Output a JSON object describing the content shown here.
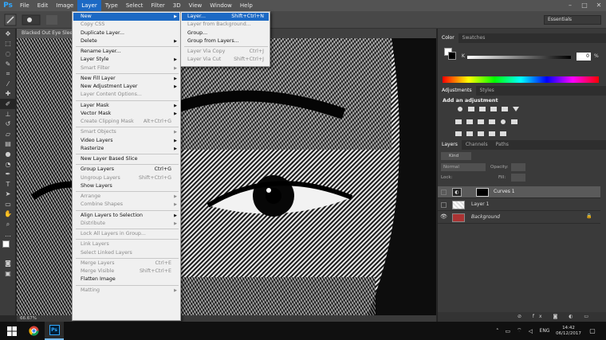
{
  "app": {
    "logo": "Ps"
  },
  "menubar": {
    "items": [
      "File",
      "Edit",
      "Image",
      "Layer",
      "Type",
      "Select",
      "Filter",
      "3D",
      "View",
      "Window",
      "Help"
    ],
    "active": "Layer"
  },
  "options": {
    "workspace": "Essentials"
  },
  "document": {
    "tab_title": "Blacked Out Eye Sleepless",
    "zoom": "66.67%"
  },
  "layer_menu": {
    "items": [
      {
        "label": "New",
        "arrow": true,
        "selected": true
      },
      {
        "label": "Copy CSS",
        "disabled": true
      },
      {
        "label": "Duplicate Layer..."
      },
      {
        "label": "Delete",
        "arrow": true
      },
      {
        "sep": true
      },
      {
        "label": "Rename Layer..."
      },
      {
        "label": "Layer Style",
        "arrow": true
      },
      {
        "label": "Smart Filter",
        "arrow": true,
        "disabled": true
      },
      {
        "sep": true
      },
      {
        "label": "New Fill Layer",
        "arrow": true
      },
      {
        "label": "New Adjustment Layer",
        "arrow": true
      },
      {
        "label": "Layer Content Options...",
        "disabled": true
      },
      {
        "sep": true
      },
      {
        "label": "Layer Mask",
        "arrow": true
      },
      {
        "label": "Vector Mask",
        "arrow": true
      },
      {
        "label": "Create Clipping Mask",
        "shortcut": "Alt+Ctrl+G",
        "disabled": true
      },
      {
        "sep": true
      },
      {
        "label": "Smart Objects",
        "arrow": true,
        "disabled": true
      },
      {
        "label": "Video Layers",
        "arrow": true
      },
      {
        "label": "Rasterize",
        "arrow": true
      },
      {
        "sep": true
      },
      {
        "label": "New Layer Based Slice"
      },
      {
        "sep": true
      },
      {
        "label": "Group Layers",
        "shortcut": "Ctrl+G"
      },
      {
        "label": "Ungroup Layers",
        "shortcut": "Shift+Ctrl+G",
        "disabled": true
      },
      {
        "label": "Show Layers"
      },
      {
        "sep": true
      },
      {
        "label": "Arrange",
        "arrow": true,
        "disabled": true
      },
      {
        "label": "Combine Shapes",
        "arrow": true,
        "disabled": true
      },
      {
        "sep": true
      },
      {
        "label": "Align Layers to Selection",
        "arrow": true
      },
      {
        "label": "Distribute",
        "arrow": true,
        "disabled": true
      },
      {
        "sep": true
      },
      {
        "label": "Lock All Layers in Group...",
        "disabled": true
      },
      {
        "sep": true
      },
      {
        "label": "Link Layers",
        "disabled": true
      },
      {
        "label": "Select Linked Layers",
        "disabled": true
      },
      {
        "sep": true
      },
      {
        "label": "Merge Layers",
        "shortcut": "Ctrl+E",
        "disabled": true
      },
      {
        "label": "Merge Visible",
        "shortcut": "Shift+Ctrl+E",
        "disabled": true
      },
      {
        "label": "Flatten Image"
      },
      {
        "sep": true
      },
      {
        "label": "Matting",
        "arrow": true,
        "disabled": true
      }
    ]
  },
  "new_submenu": {
    "items": [
      {
        "label": "Layer...",
        "shortcut": "Shift+Ctrl+N",
        "selected": true
      },
      {
        "label": "Layer from Background...",
        "disabled": true
      },
      {
        "label": "Group..."
      },
      {
        "label": "Group from Layers..."
      },
      {
        "sep": true
      },
      {
        "label": "Layer Via Copy",
        "shortcut": "Ctrl+J",
        "disabled": true
      },
      {
        "label": "Layer Via Cut",
        "shortcut": "Shift+Ctrl+J",
        "disabled": true
      }
    ]
  },
  "color_panel": {
    "tabs": [
      "Color",
      "Swatches"
    ],
    "slider_label": "K",
    "value": "0",
    "unit": "%"
  },
  "adjustments_panel": {
    "tabs": [
      "Adjustments",
      "Styles"
    ],
    "heading": "Add an adjustment"
  },
  "layers_panel": {
    "tabs": [
      "Layers",
      "Channels",
      "Paths"
    ],
    "kind": "Kind",
    "blend_mode": "Normal",
    "opacity_label": "Opacity:",
    "lock_label": "Lock:",
    "fill_label": "Fill:",
    "layers": [
      {
        "name": "Curves 1",
        "visible": false,
        "selected": true
      },
      {
        "name": "Layer 1",
        "visible": false
      },
      {
        "name": "Background",
        "visible": true,
        "locked": true
      }
    ]
  },
  "taskbar": {
    "language": "ENG",
    "time": "14:42",
    "date": "06/12/2017"
  }
}
